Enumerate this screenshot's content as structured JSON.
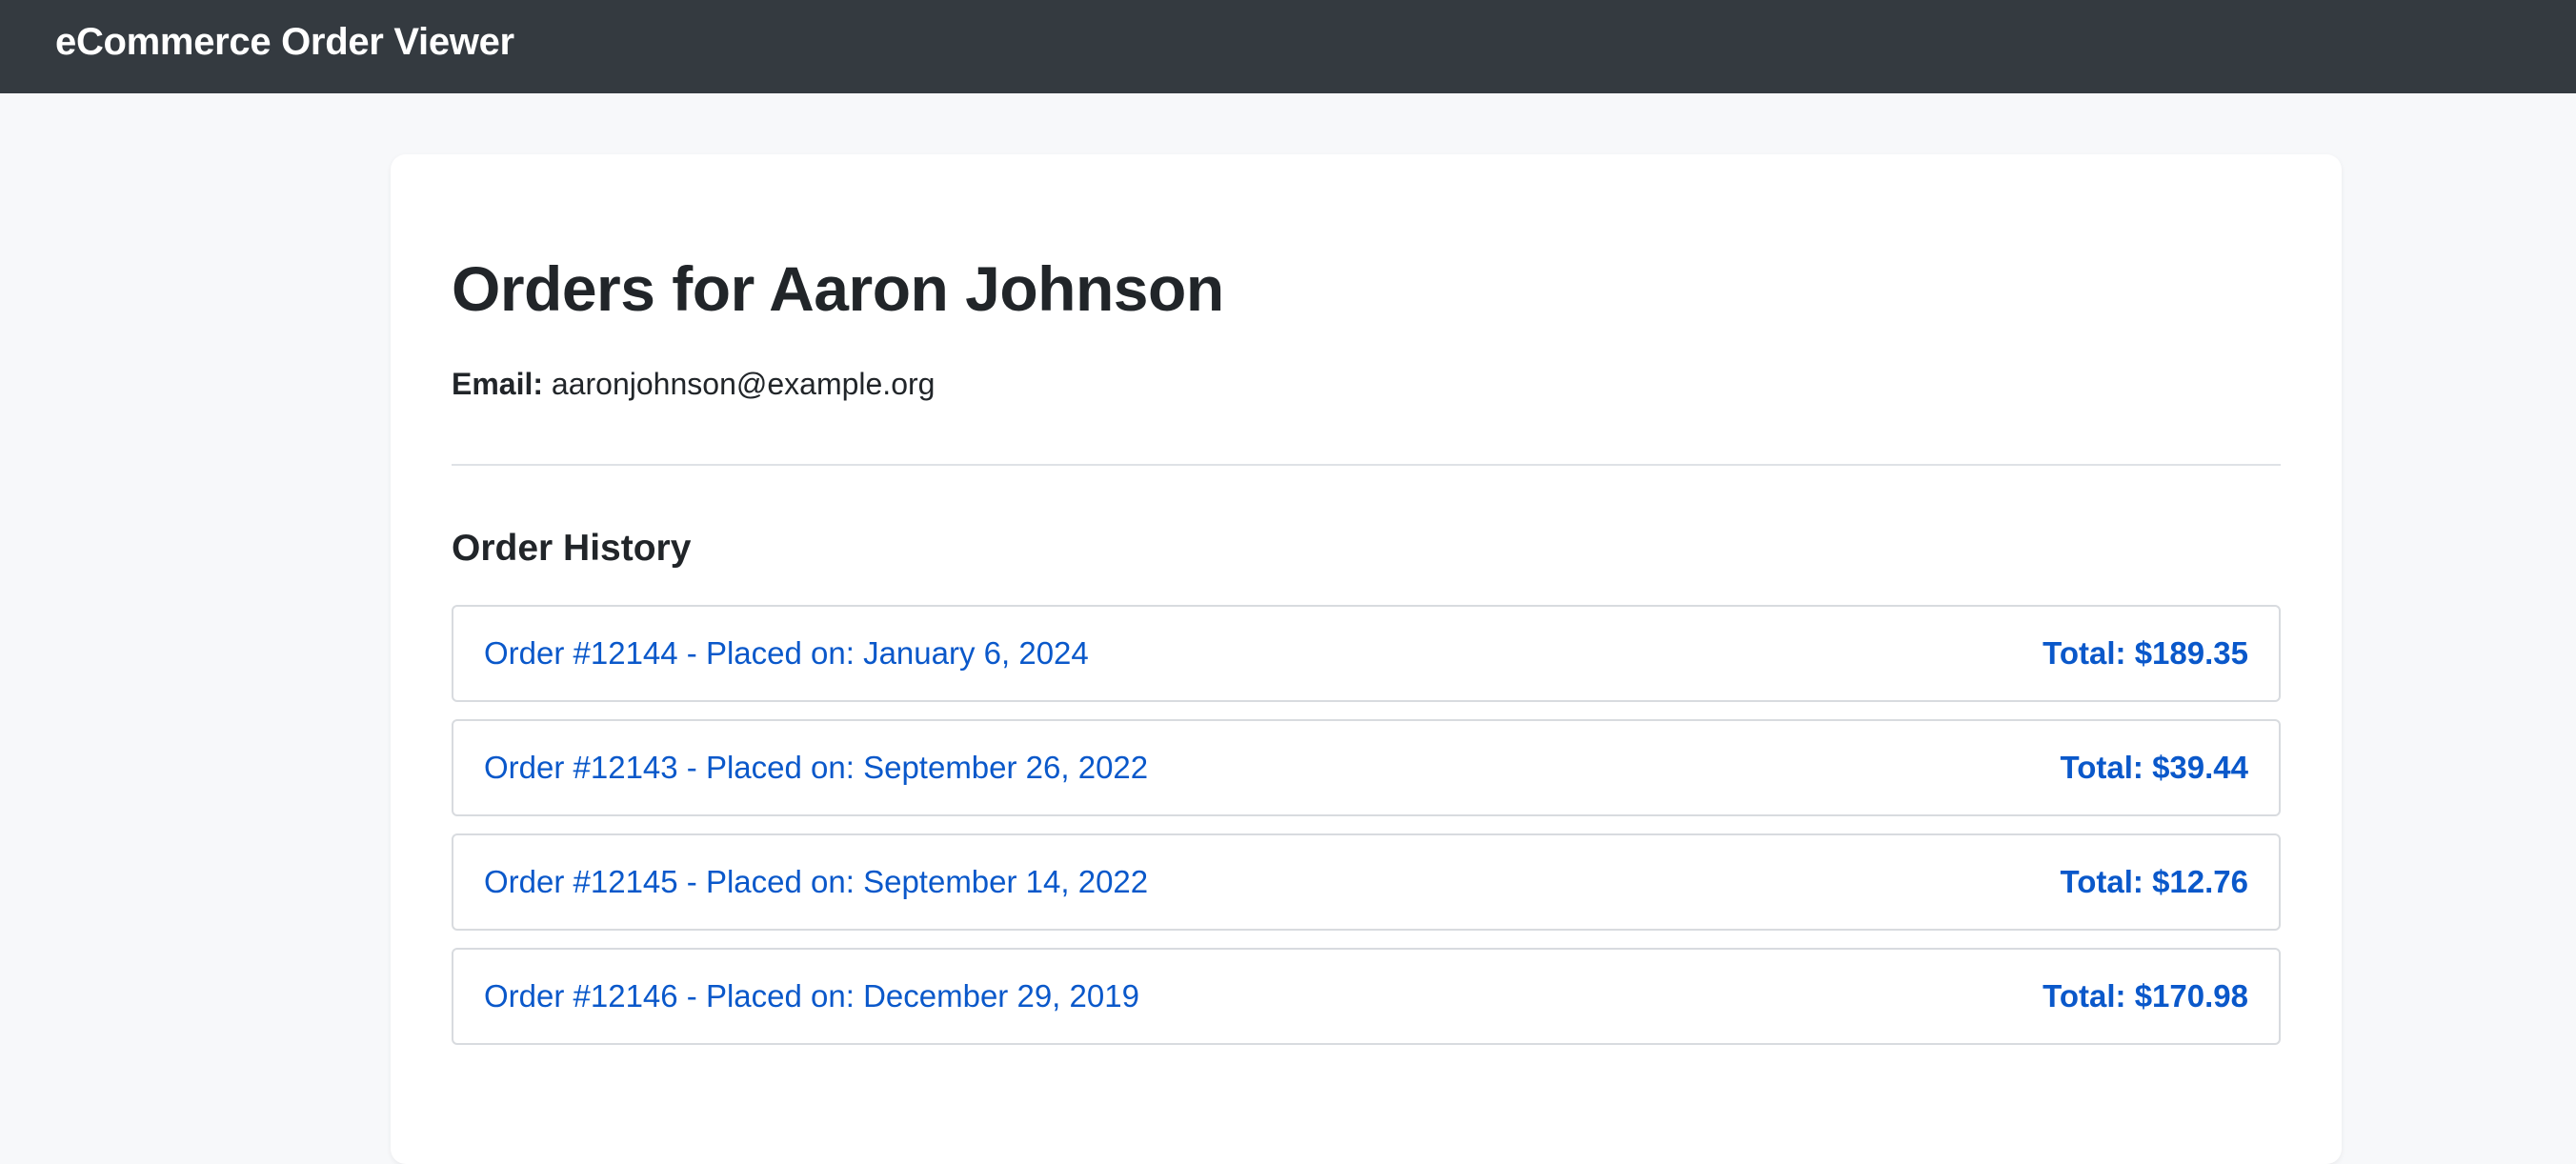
{
  "navbar": {
    "brand": "eCommerce Order Viewer"
  },
  "customer": {
    "heading": "Orders for Aaron Johnson",
    "email_label": "Email:",
    "email": "aaronjohnson@example.org"
  },
  "order_history": {
    "title": "Order History",
    "orders": [
      {
        "label": "Order #12144 - Placed on: January 6, 2024",
        "total": "Total: $189.35"
      },
      {
        "label": "Order #12143 - Placed on: September 26, 2022",
        "total": "Total: $39.44"
      },
      {
        "label": "Order #12145 - Placed on: September 14, 2022",
        "total": "Total: $12.76"
      },
      {
        "label": "Order #12146 - Placed on: December 29, 2019",
        "total": "Total: $170.98"
      }
    ]
  },
  "colors": {
    "navbar_bg": "#343a40",
    "page_bg": "#f7f8fa",
    "link": "#0a58ca",
    "text": "#212529"
  }
}
